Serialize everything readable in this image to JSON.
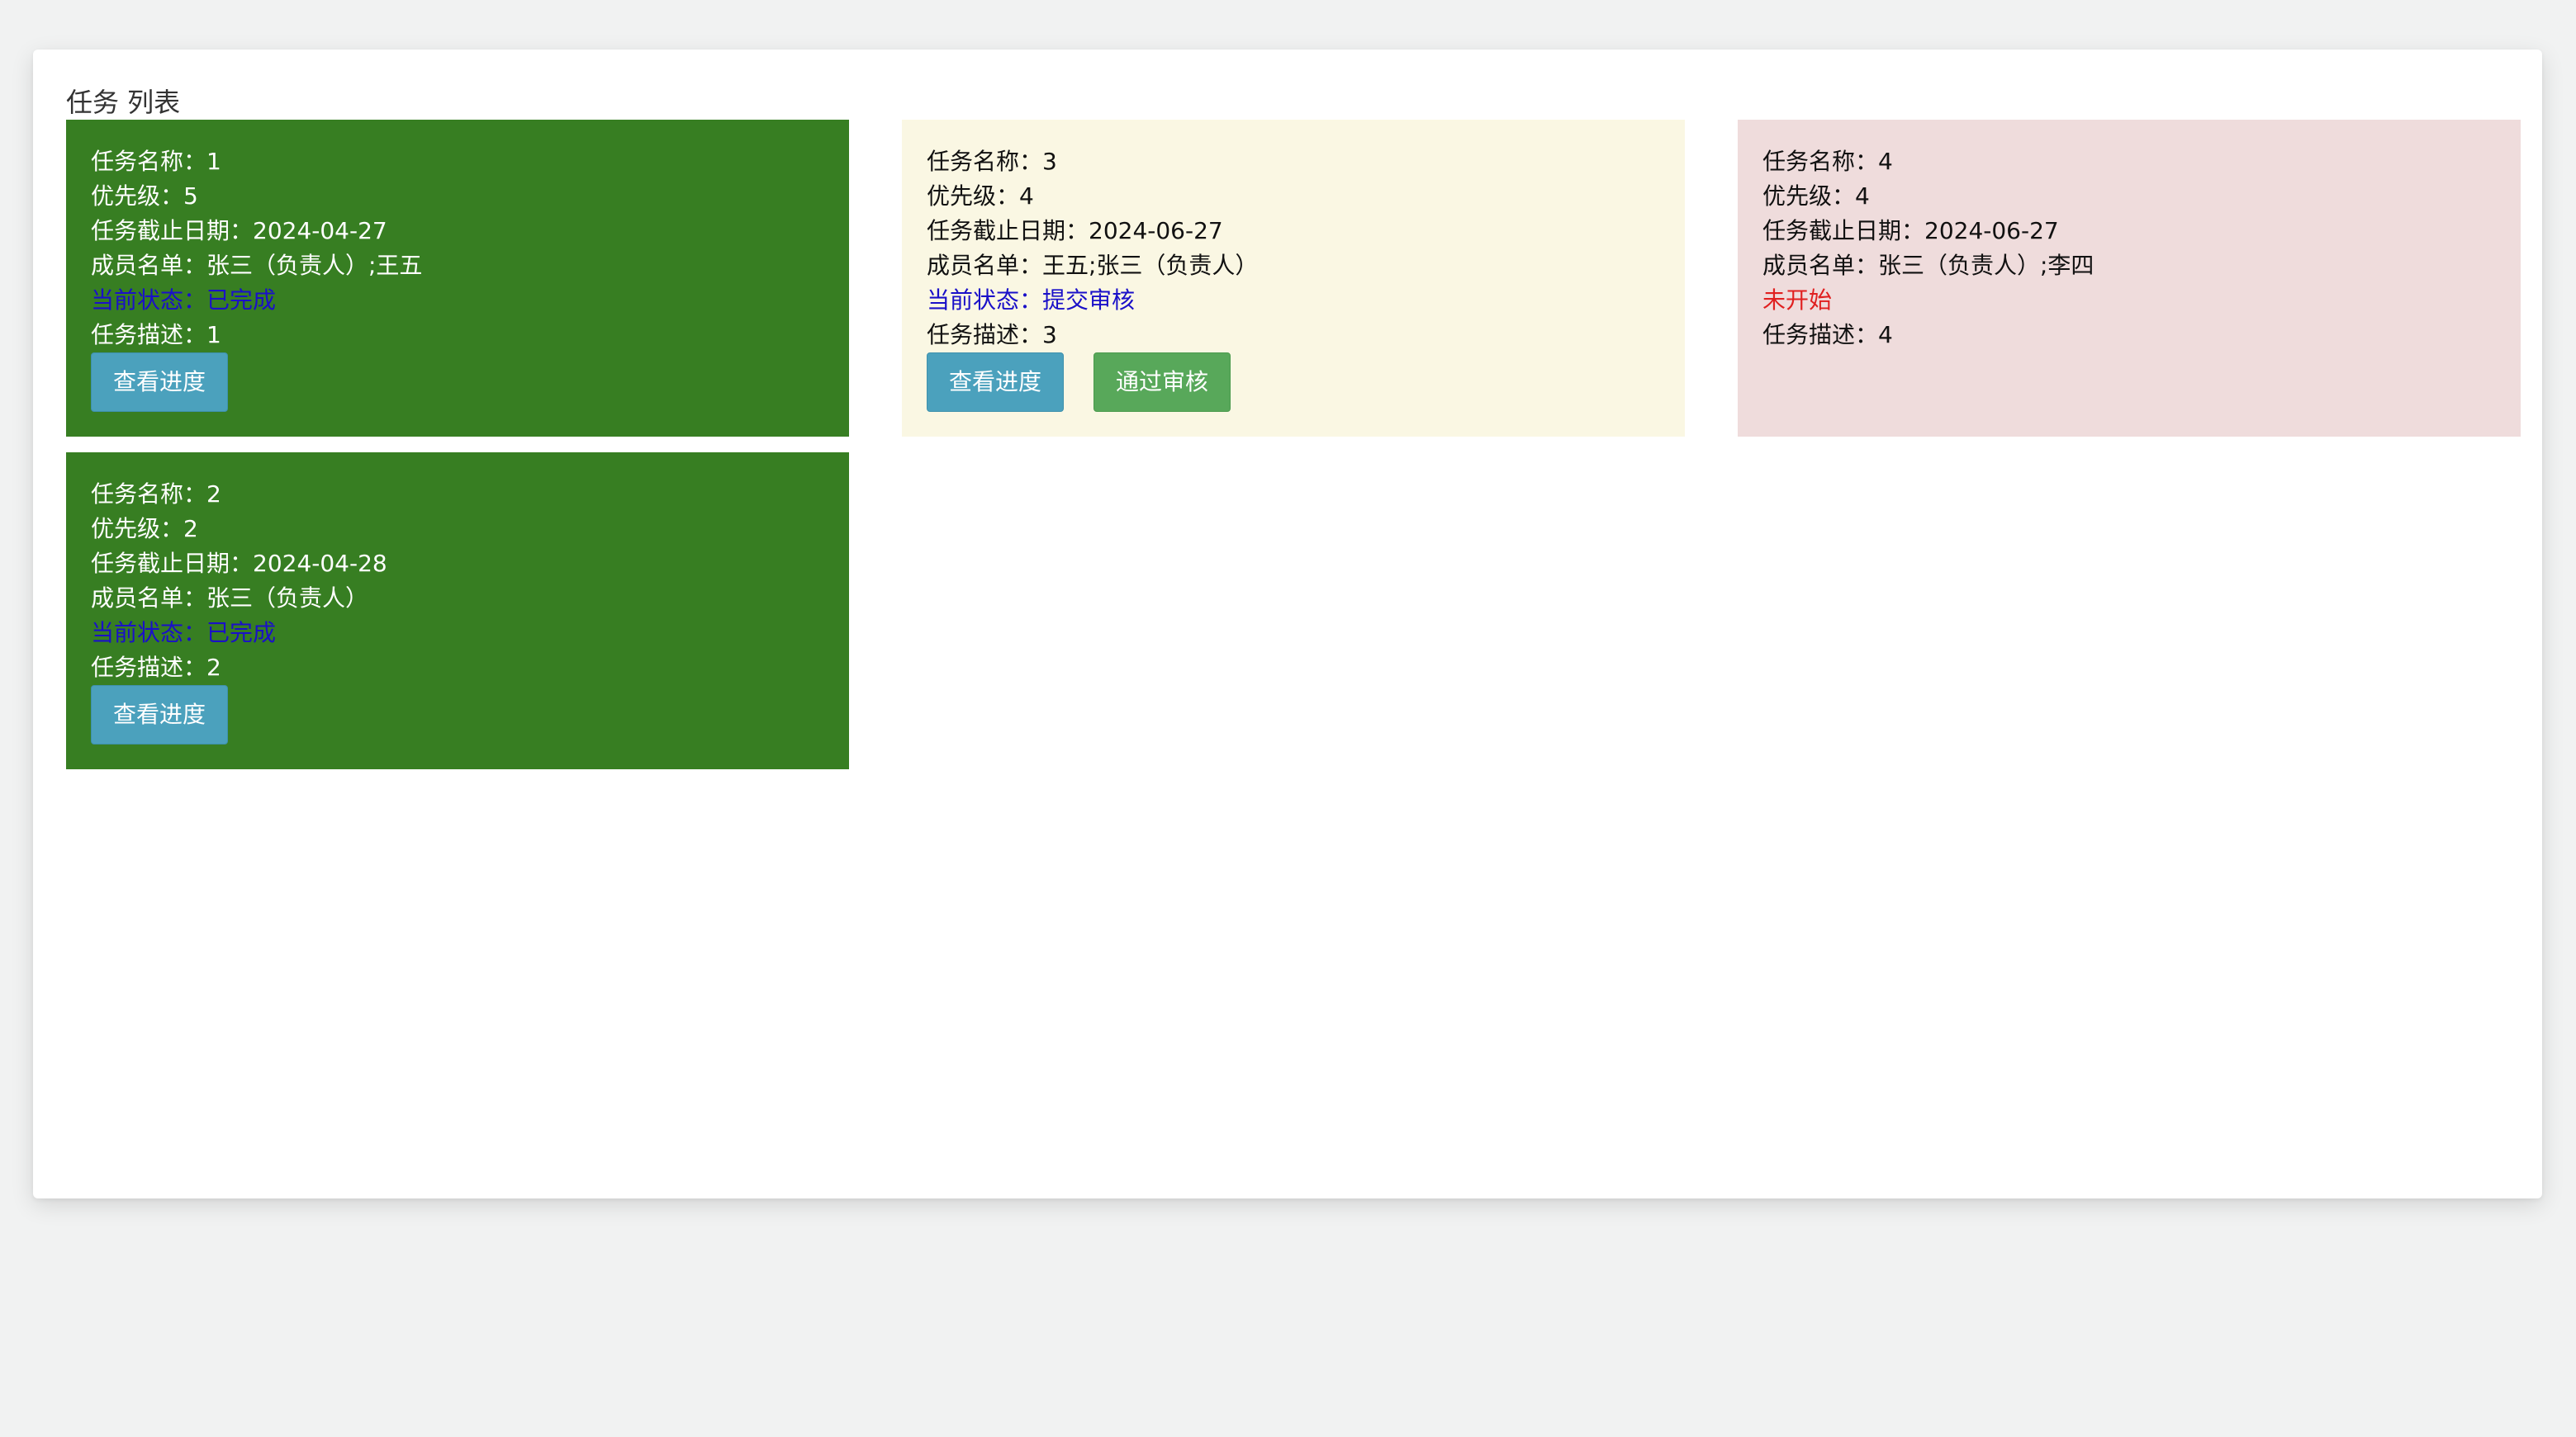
{
  "title": "任务 列表",
  "colors": {
    "completed_bg": "#377e22",
    "review_bg": "#faf7e3",
    "notstarted_bg": "#efdcdc",
    "status_blue": "#1a10c8",
    "status_red": "#e02020"
  },
  "tasks": [
    {
      "name": "任务名称：1",
      "priority": "优先级：5",
      "deadline": "任务截止日期：2024-04-27",
      "members": "成员名单：张三（负责人）;王五",
      "status": "当前状态：已完成",
      "description": "任务描述：1",
      "progress_label": "查看进度"
    },
    {
      "name": "任务名称：3",
      "priority": "优先级：4",
      "deadline": "任务截止日期：2024-06-27",
      "members": "成员名单：王五;张三（负责人）",
      "status": "当前状态：提交审核",
      "description": "任务描述：3",
      "progress_label": "查看进度",
      "approve_label": "通过审核"
    },
    {
      "name": "任务名称：4",
      "priority": "优先级：4",
      "deadline": "任务截止日期：2024-06-27",
      "members": "成员名单：张三（负责人）;李四",
      "status": "未开始",
      "description": "任务描述：4"
    },
    {
      "name": "任务名称：2",
      "priority": "优先级：2",
      "deadline": "任务截止日期：2024-04-28",
      "members": "成员名单：张三（负责人）",
      "status": "当前状态：已完成",
      "description": "任务描述：2",
      "progress_label": "查看进度"
    }
  ]
}
